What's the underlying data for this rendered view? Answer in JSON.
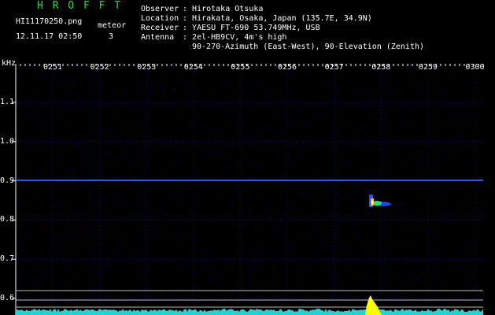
{
  "header": {
    "title": "H R O F F T",
    "file_name": "HI11170250.png",
    "timestamp": "12.11.17 02:50",
    "meteor_label": "meteor",
    "meteor_count": "3",
    "info_lines": [
      {
        "key": "Observer",
        "value": "Hirotaka Otsuka"
      },
      {
        "key": "Location",
        "value": "Hirakata, Osaka, Japan (135.7E, 34.9N)"
      },
      {
        "key": "Receiver",
        "value": "YAESU FT-690 53.749MHz, USB"
      },
      {
        "key": "Antenna",
        "value": "2el-HB9CV, 4m's high"
      }
    ],
    "info_extra": "90-270-Azimuth (East-West), 90-Elevation (Zenith)"
  },
  "axis": {
    "y_unit": "kHz",
    "y_ticks": [
      "1.1",
      "1.0",
      "0.9",
      "0.8",
      "0.7",
      "0.6"
    ],
    "x_ticks": [
      "0251",
      "0252",
      "0253",
      "0254",
      "0255",
      "0256",
      "0257",
      "0258",
      "0259",
      "0300"
    ]
  },
  "colors": {
    "background": "#000000",
    "grid": "#0a0a8a",
    "carrier_line": "#1a5cff",
    "meteor_core": "#ffffff",
    "meteor_warm": "#ffcc00",
    "meteor_green": "#30e060",
    "meteor_blue": "#2050ff",
    "level_trace": "#22d3d3",
    "signal_spike": "#ffff00",
    "header_text": "#ffffff",
    "title_text": "#35d54a"
  }
}
